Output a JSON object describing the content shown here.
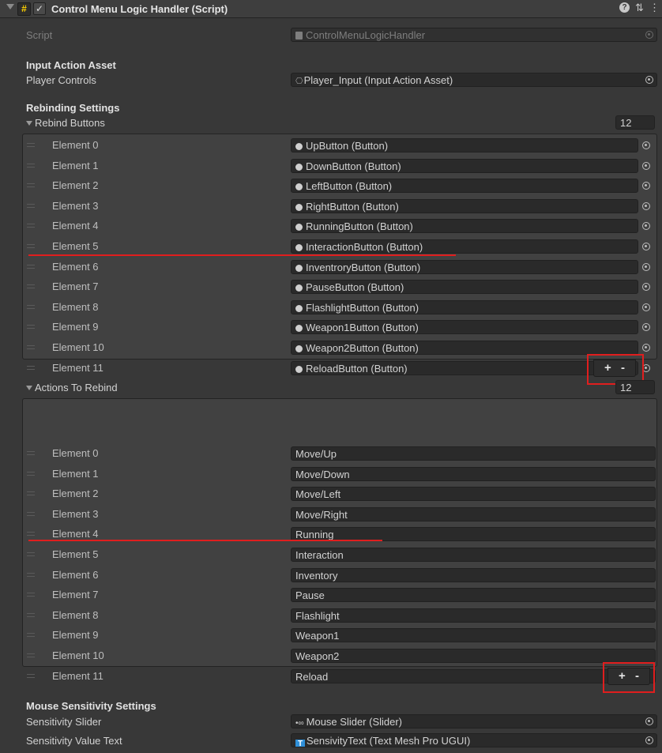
{
  "header": {
    "title": "Control Menu Logic Handler (Script)"
  },
  "script": {
    "label": "Script",
    "value": "ControlMenuLogicHandler"
  },
  "input_action_asset": {
    "heading": "Input Action Asset",
    "player_controls_label": "Player Controls",
    "player_controls_value": "Player_Input (Input Action Asset)"
  },
  "rebinding": {
    "heading": "Rebinding Settings",
    "rebind_buttons": {
      "label": "Rebind Buttons",
      "size": "12",
      "elements": [
        {
          "label": "Element 0",
          "value": "UpButton (Button)"
        },
        {
          "label": "Element 1",
          "value": "DownButton (Button)"
        },
        {
          "label": "Element 2",
          "value": "LeftButton (Button)"
        },
        {
          "label": "Element 3",
          "value": "RightButton (Button)"
        },
        {
          "label": "Element 4",
          "value": "RunningButton (Button)"
        },
        {
          "label": "Element 5",
          "value": "InteractionButton (Button)"
        },
        {
          "label": "Element 6",
          "value": "InventroryButton (Button)"
        },
        {
          "label": "Element 7",
          "value": "PauseButton (Button)"
        },
        {
          "label": "Element 8",
          "value": "FlashlightButton (Button)"
        },
        {
          "label": "Element 9",
          "value": "Weapon1Button (Button)"
        },
        {
          "label": "Element 10",
          "value": "Weapon2Button (Button)"
        },
        {
          "label": "Element 11",
          "value": "ReloadButton (Button)"
        }
      ]
    },
    "actions_to_rebind": {
      "label": "Actions To Rebind",
      "size": "12",
      "elements": [
        {
          "label": "Element 0",
          "value": "Move/Up"
        },
        {
          "label": "Element 1",
          "value": "Move/Down"
        },
        {
          "label": "Element 2",
          "value": "Move/Left"
        },
        {
          "label": "Element 3",
          "value": "Move/Right"
        },
        {
          "label": "Element 4",
          "value": "Running"
        },
        {
          "label": "Element 5",
          "value": "Interaction"
        },
        {
          "label": "Element 6",
          "value": "Inventory"
        },
        {
          "label": "Element 7",
          "value": "Pause"
        },
        {
          "label": "Element 8",
          "value": "Flashlight"
        },
        {
          "label": "Element 9",
          "value": "Weapon1"
        },
        {
          "label": "Element 10",
          "value": "Weapon2"
        },
        {
          "label": "Element 11",
          "value": "Reload"
        }
      ]
    },
    "add_symbol": "+",
    "remove_symbol": "-"
  },
  "mouse": {
    "heading": "Mouse Sensitivity Settings",
    "slider_label": "Sensitivity Slider",
    "slider_value": "Mouse Slider (Slider)",
    "text_label": "Sensitivity Value Text",
    "text_value": "SensivityText (Text Mesh Pro UGUI)"
  },
  "colors": {
    "annotation": "#e01e1e",
    "script_icon": "#ffd200",
    "tmp_icon": "#2f8fd8"
  }
}
